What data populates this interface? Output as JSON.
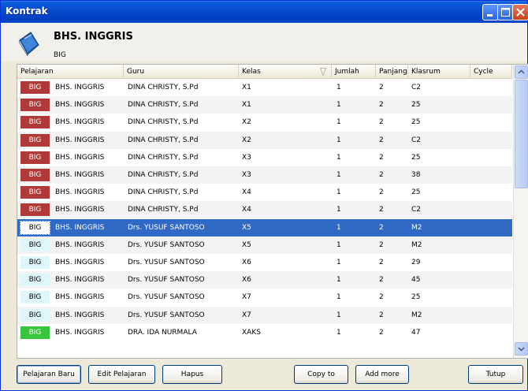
{
  "window": {
    "title": "Kontrak"
  },
  "header": {
    "title": "BHS. INGGRIS",
    "code": "BIG",
    "icon": "book-icon"
  },
  "table": {
    "columns": [
      "Pelajaran",
      "Guru",
      "Kelas",
      "Jumlah",
      "Panjang",
      "Klasrum",
      "Cycle"
    ],
    "rows": [
      {
        "code": "BIG",
        "badge_color": "#b03a3a",
        "subject": "BHS. INGGRIS",
        "teacher": "DINA CHRISTY, S.Pd",
        "class": "X1",
        "jumlah": "1",
        "panjang": "2",
        "room": "C2",
        "cycle": ""
      },
      {
        "code": "BIG",
        "badge_color": "#b03a3a",
        "subject": "BHS. INGGRIS",
        "teacher": "DINA CHRISTY, S.Pd",
        "class": "X1",
        "jumlah": "1",
        "panjang": "2",
        "room": "25",
        "cycle": ""
      },
      {
        "code": "BIG",
        "badge_color": "#b03a3a",
        "subject": "BHS. INGGRIS",
        "teacher": "DINA CHRISTY, S.Pd",
        "class": "X2",
        "jumlah": "1",
        "panjang": "2",
        "room": "25",
        "cycle": ""
      },
      {
        "code": "BIG",
        "badge_color": "#b03a3a",
        "subject": "BHS. INGGRIS",
        "teacher": "DINA CHRISTY, S.Pd",
        "class": "X2",
        "jumlah": "1",
        "panjang": "2",
        "room": "C2",
        "cycle": ""
      },
      {
        "code": "BIG",
        "badge_color": "#b03a3a",
        "subject": "BHS. INGGRIS",
        "teacher": "DINA CHRISTY, S.Pd",
        "class": "X3",
        "jumlah": "1",
        "panjang": "2",
        "room": "25",
        "cycle": ""
      },
      {
        "code": "BIG",
        "badge_color": "#b03a3a",
        "subject": "BHS. INGGRIS",
        "teacher": "DINA CHRISTY, S.Pd",
        "class": "X3",
        "jumlah": "1",
        "panjang": "2",
        "room": "38",
        "cycle": ""
      },
      {
        "code": "BIG",
        "badge_color": "#b03a3a",
        "subject": "BHS. INGGRIS",
        "teacher": "DINA CHRISTY, S.Pd",
        "class": "X4",
        "jumlah": "1",
        "panjang": "2",
        "room": "25",
        "cycle": ""
      },
      {
        "code": "BIG",
        "badge_color": "#b03a3a",
        "subject": "BHS. INGGRIS",
        "teacher": "DINA CHRISTY, S.Pd",
        "class": "X4",
        "jumlah": "1",
        "panjang": "2",
        "room": "C2",
        "cycle": ""
      },
      {
        "code": "BIG",
        "badge_color": "#dff7fb",
        "subject": "BHS. INGGRIS",
        "teacher": "Drs. YUSUF SANTOSO",
        "class": "X5",
        "jumlah": "1",
        "panjang": "2",
        "room": "M2",
        "cycle": "",
        "selected": true
      },
      {
        "code": "BIG",
        "badge_color": "#dff7fb",
        "subject": "BHS. INGGRIS",
        "teacher": "Drs. YUSUF SANTOSO",
        "class": "X5",
        "jumlah": "1",
        "panjang": "2",
        "room": "M2",
        "cycle": ""
      },
      {
        "code": "BIG",
        "badge_color": "#dff7fb",
        "subject": "BHS. INGGRIS",
        "teacher": "Drs. YUSUF SANTOSO",
        "class": "X6",
        "jumlah": "1",
        "panjang": "2",
        "room": "29",
        "cycle": ""
      },
      {
        "code": "BIG",
        "badge_color": "#dff7fb",
        "subject": "BHS. INGGRIS",
        "teacher": "Drs. YUSUF SANTOSO",
        "class": "X6",
        "jumlah": "1",
        "panjang": "2",
        "room": "45",
        "cycle": ""
      },
      {
        "code": "BIG",
        "badge_color": "#dff7fb",
        "subject": "BHS. INGGRIS",
        "teacher": "Drs. YUSUF SANTOSO",
        "class": "X7",
        "jumlah": "1",
        "panjang": "2",
        "room": "25",
        "cycle": ""
      },
      {
        "code": "BIG",
        "badge_color": "#dff7fb",
        "subject": "BHS. INGGRIS",
        "teacher": "Drs. YUSUF SANTOSO",
        "class": "X7",
        "jumlah": "1",
        "panjang": "2",
        "room": "M2",
        "cycle": ""
      },
      {
        "code": "BIG",
        "badge_color": "#38c43c",
        "subject": "BHS. INGGRIS",
        "teacher": "DRA. IDA NURMALA",
        "class": "XAKS",
        "jumlah": "1",
        "panjang": "2",
        "room": "47",
        "cycle": ""
      }
    ]
  },
  "buttons": {
    "pelajaran_baru": "Pelajaran Baru",
    "edit_pelajaran": "Edit Pelajaran",
    "hapus": "Hapus",
    "copy_to": "Copy to",
    "add_more": "Add more",
    "tutup": "Tutup"
  },
  "colors": {
    "selection": "#316ac5",
    "titlebar": "#0549cb"
  }
}
